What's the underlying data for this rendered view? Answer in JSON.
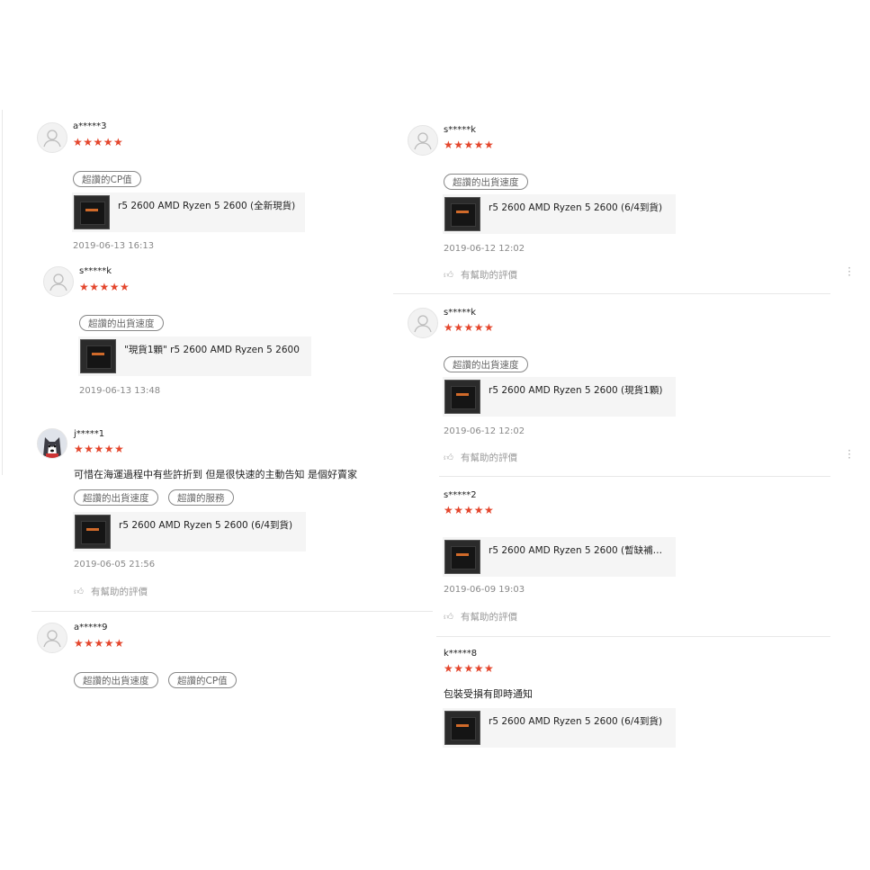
{
  "helpful_label": "有幫助的評價",
  "colors": {
    "star": "#e4462d",
    "product_bg": "#f5f5f5",
    "tag_border": "#888888"
  },
  "left_reviews": [
    {
      "username": "a*****3",
      "stars": "★★★★★",
      "tags": [
        "超讚的CP值"
      ],
      "product": "r5 2600 AMD Ryzen 5 2600 (全新現貨)",
      "date": "2019-06-13 16:13"
    },
    {
      "username": "s*****k",
      "stars": "★★★★★",
      "tags": [
        "超讚的出貨速度"
      ],
      "product": "\"現貨1顆\" r5 2600 AMD Ryzen 5 2600",
      "date": "2019-06-13 13:48"
    },
    {
      "username": "j*****1",
      "stars": "★★★★★",
      "comment": "可惜在海運過程中有些許折到 但是很快速的主動告知 是個好賣家",
      "tags": [
        "超讚的出貨速度",
        "超讚的服務"
      ],
      "product": "r5 2600 AMD Ryzen 5 2600 (6/4到貨)",
      "date": "2019-06-05 21:56"
    },
    {
      "username": "a*****9",
      "stars": "★★★★★",
      "tags": [
        "超讚的出貨速度",
        "超讚的CP值"
      ]
    }
  ],
  "right_reviews": [
    {
      "username": "s*****k",
      "stars": "★★★★★",
      "tags": [
        "超讚的出貨速度"
      ],
      "product": "r5 2600 AMD Ryzen 5 2600 (6/4到貨)",
      "date": "2019-06-12 12:02"
    },
    {
      "username": "s*****k",
      "stars": "★★★★★",
      "tags": [
        "超讚的出貨速度"
      ],
      "product": "r5 2600 AMD Ryzen 5 2600 (現貨1顆)",
      "date": "2019-06-12 12:02"
    },
    {
      "username": "s*****2",
      "stars": "★★★★★",
      "product": "r5 2600 AMD Ryzen 5 2600 (暫缺補貨...",
      "date": "2019-06-09 19:03"
    },
    {
      "username": "k*****8",
      "stars": "★★★★★",
      "comment": "包裝受損有即時通知",
      "product": "r5 2600 AMD Ryzen 5 2600 (6/4到貨)"
    }
  ]
}
